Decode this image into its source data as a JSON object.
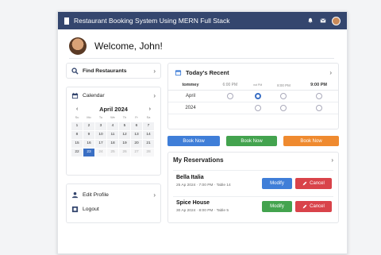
{
  "header": {
    "title": "Restaurant Booking System Using MERN Full Stack"
  },
  "welcome": {
    "text": "Welcome, John!"
  },
  "left_menu": {
    "find_restaurants": "Find Restaurants",
    "calendar": "Calendar",
    "edit_profile": "Edit Profile",
    "logout": "Logout"
  },
  "calendar": {
    "month": "April 2024",
    "prev": "‹",
    "next": "›",
    "day_names": [
      "Su",
      "Mo",
      "Tu",
      "We",
      "Th",
      "Fr",
      "Sa"
    ],
    "rows": [
      [
        "1",
        "2",
        "3",
        "4",
        "5",
        "6",
        "7"
      ],
      [
        "8",
        "9",
        "10",
        "11",
        "12",
        "13",
        "14"
      ],
      [
        "15",
        "16",
        "17",
        "18",
        "19",
        "20",
        "21"
      ],
      [
        "22",
        "23",
        "24",
        "25",
        "26",
        "27",
        "28"
      ]
    ],
    "selected": "23"
  },
  "recent": {
    "title": "Today's Recent",
    "col_headers": [
      "tommey",
      "6:00 PM",
      "not PM",
      "8:00 PM",
      "9:00 PM"
    ],
    "rows": [
      {
        "label": "April",
        "selected_index": 1
      },
      {
        "label": "2024",
        "selected_index": -1
      }
    ]
  },
  "book_buttons": [
    "Book Now",
    "Book Now",
    "Book Now"
  ],
  "reservations": {
    "title": "My Reservations",
    "items": [
      {
        "name": "Bella Italia",
        "details": "25 Ap 2024 · 7:00 PM · Table 14"
      },
      {
        "name": "Spice House",
        "details": "30 Ap 2024 · 8:00 PM · Table 5"
      }
    ],
    "modify_label": "Modify",
    "cancel_label": "Cancel"
  },
  "colors": {
    "topbar": "#34466e",
    "blue": "#3f7ed8",
    "green": "#43a34e",
    "orange": "#ef8a2f",
    "red": "#d9434a",
    "selected_day": "#3a6fc4"
  },
  "icons": {
    "bell": "bell-icon",
    "mail": "mail-icon",
    "search": "search-icon",
    "calendar": "calendar-icon",
    "user": "user-icon",
    "logout": "logout-icon",
    "pencil": "pencil-icon"
  }
}
